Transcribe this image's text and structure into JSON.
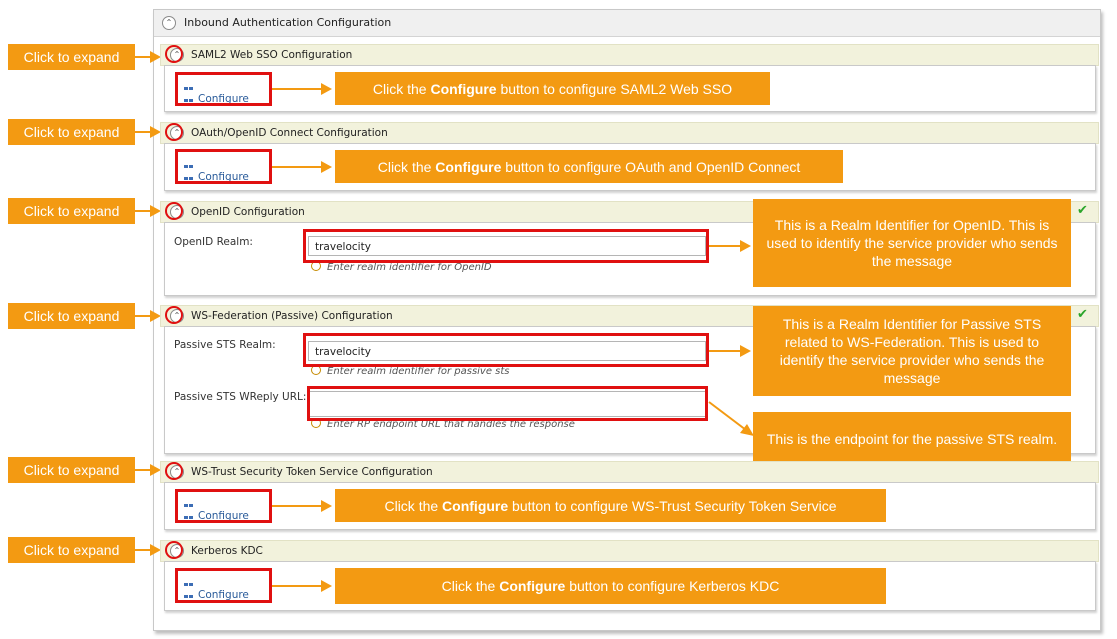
{
  "inbound": {
    "title": "Inbound Authentication Configuration"
  },
  "expand_label": "Click to expand",
  "sections": {
    "saml": {
      "title": "SAML2 Web SSO Configuration",
      "button": "Configure",
      "callout_pre": "Click the ",
      "callout_bold": "Configure",
      "callout_post": " button to configure SAML2 Web SSO"
    },
    "oauth": {
      "title": "OAuth/OpenID Connect Configuration",
      "button": "Configure",
      "callout_pre": "Click the ",
      "callout_bold": "Configure",
      "callout_post": " button to configure OAuth and OpenID Connect"
    },
    "openid": {
      "title": "OpenID Configuration",
      "realm_label": "OpenID Realm:",
      "realm_value": "travelocity",
      "realm_hint": "Enter realm identifier for OpenID",
      "callout": "This is a Realm Identifier for OpenID. This is used to identify the service provider who sends the message"
    },
    "wsfed": {
      "title": "WS-Federation (Passive) Configuration",
      "realm_label": "Passive STS Realm:",
      "realm_value": "travelocity",
      "realm_hint": "Enter realm identifier for passive sts",
      "wreply_label": "Passive STS WReply URL:",
      "wreply_value": "",
      "wreply_hint": "Enter RP endpoint URL that handles the response",
      "callout_realm": "This is a Realm Identifier for Passive STS related to WS-Federation. This is used to identify the service provider who sends the message",
      "callout_endpoint": "This is the endpoint for the passive STS realm."
    },
    "wstrust": {
      "title": "WS-Trust Security Token Service Configuration",
      "button": "Configure",
      "callout_pre": "Click the ",
      "callout_bold": "Configure",
      "callout_post": " button to configure WS-Trust Security Token Service"
    },
    "kerberos": {
      "title": "Kerberos KDC",
      "button": "Configure",
      "callout_pre": "Click the ",
      "callout_bold": "Configure",
      "callout_post": " button to configure Kerberos KDC"
    }
  },
  "colors": {
    "callout": "#f39a12",
    "highlight": "#e01010",
    "section_header": "#f2f2dc",
    "link": "#2a5b9a"
  }
}
